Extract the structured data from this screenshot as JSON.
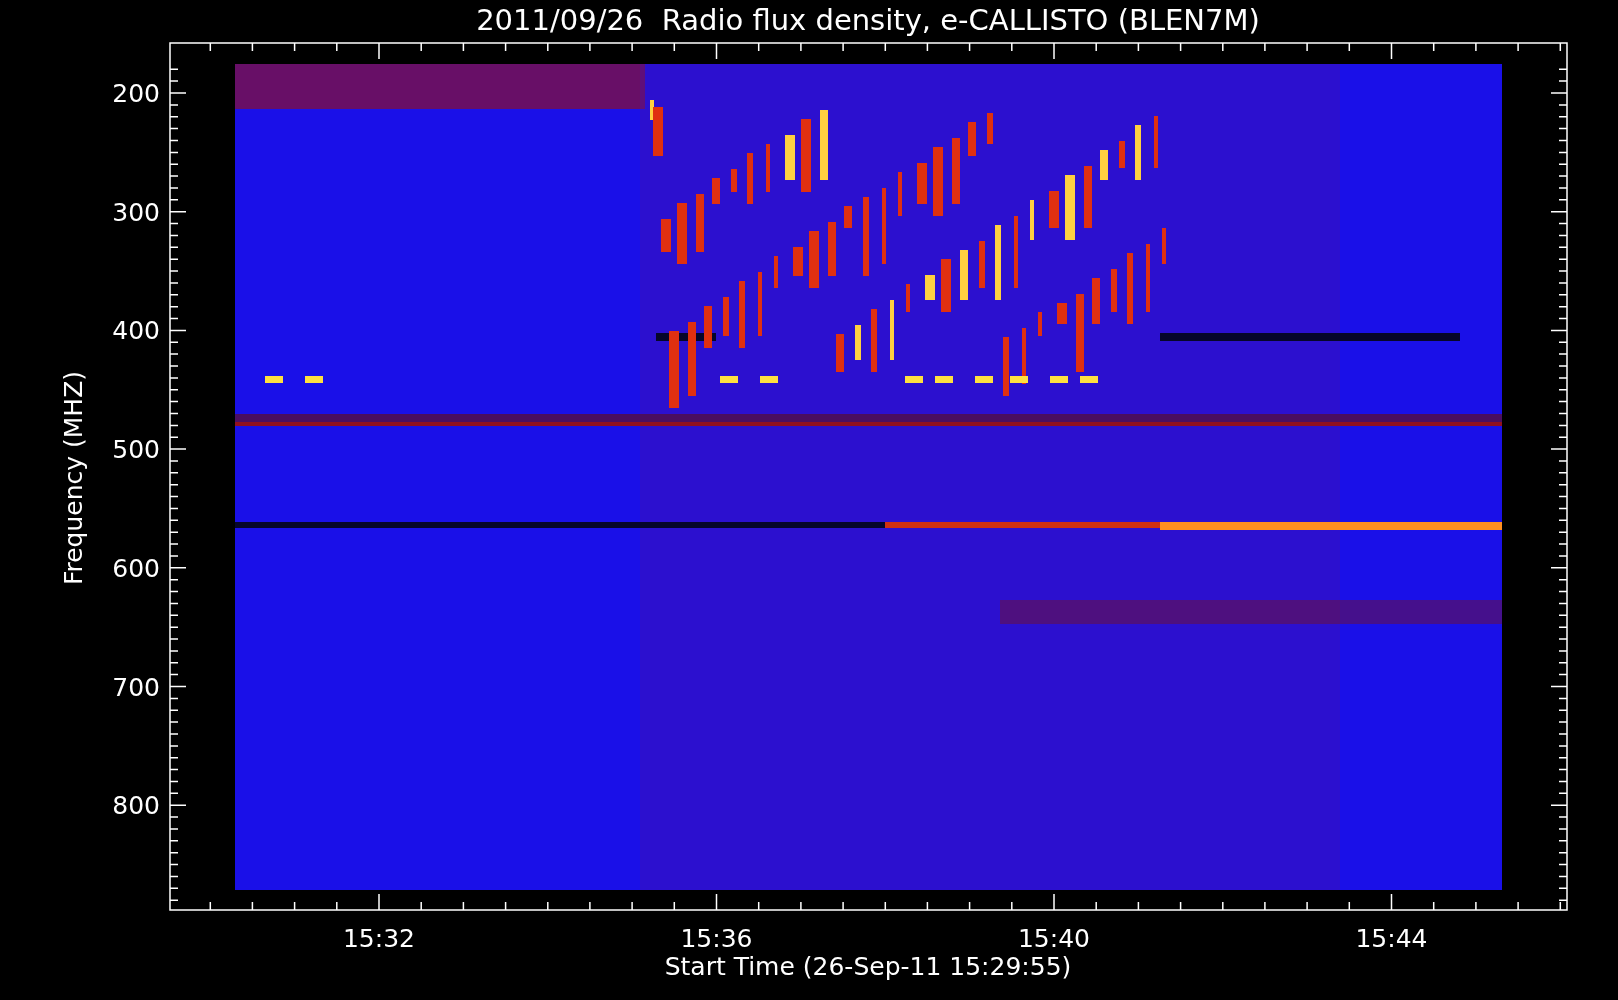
{
  "title": "2011/09/26  Radio flux density, e-CALLISTO (BLEN7M)",
  "y_axis": {
    "label": "Frequency (MHZ)",
    "ticks": [
      "200",
      "300",
      "400",
      "500",
      "600",
      "700",
      "800"
    ]
  },
  "x_axis": {
    "label": "Start Time (26-Sep-11 15:29:55)",
    "ticks": [
      "15:32",
      "15:36",
      "15:40",
      "15:44"
    ]
  }
}
